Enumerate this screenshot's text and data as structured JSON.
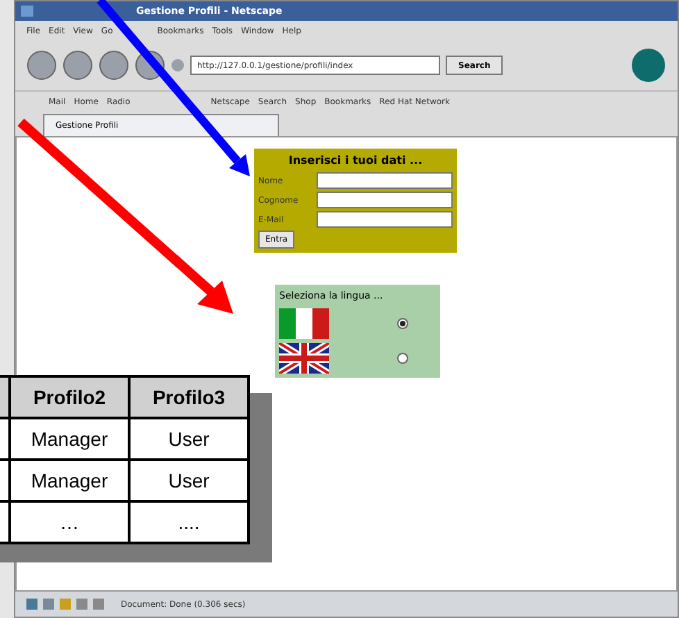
{
  "window": {
    "title": "Gestione Profili - Netscape"
  },
  "menu": [
    "File",
    "Edit",
    "View",
    "Go",
    "Bookmarks",
    "Tools",
    "Window",
    "Help"
  ],
  "url": "http://127.0.0.1/gestione/profili/index",
  "search_button": "Search",
  "bookmarks": [
    "Mail",
    "Home",
    "Radio",
    "Netscape",
    "Search",
    "Shop",
    "Bookmarks",
    "Red Hat Network"
  ],
  "tabs": [
    {
      "label": "Gestione Profili",
      "selected": true
    }
  ],
  "login_form": {
    "title": "Inserisci i tuoi dati ...",
    "fields": [
      {
        "label": "Nome"
      },
      {
        "label": "Cognome"
      },
      {
        "label": "E-Mail"
      }
    ],
    "button": "Entra"
  },
  "language_box": {
    "title": "Seleziona la lingua ...",
    "options": [
      {
        "kind": "italy",
        "selected": true
      },
      {
        "kind": "uk",
        "selected": false
      }
    ]
  },
  "status_bar": {
    "text": "Document: Done (0.306 secs)"
  },
  "overlay_table": {
    "columns": [
      "Profilo2",
      "Profilo3"
    ],
    "rows": [
      [
        "Manager",
        "User"
      ],
      [
        "Manager",
        "User"
      ],
      [
        "…",
        "...."
      ]
    ]
  }
}
